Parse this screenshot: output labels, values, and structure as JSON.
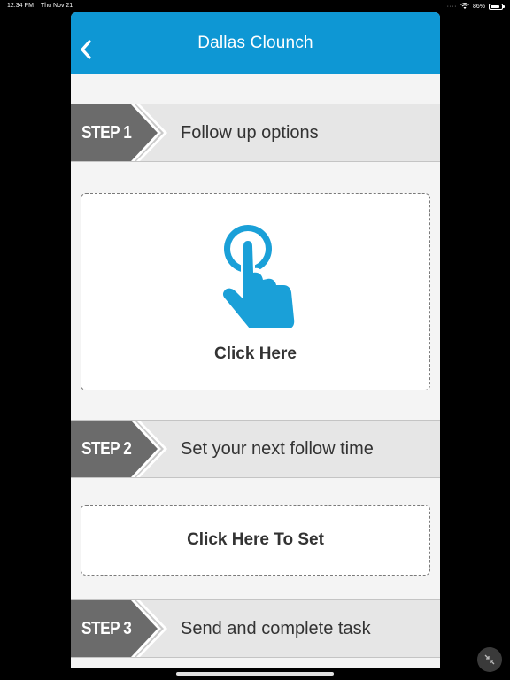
{
  "status_bar": {
    "time": "12:34 PM",
    "date": "Thu Nov 21",
    "battery": "86%",
    "battery_level": 0.86
  },
  "header": {
    "title": "Dallas Clounch",
    "back_icon": "chevron-left-icon"
  },
  "steps": [
    {
      "label": "STEP 1",
      "text": "Follow up options"
    },
    {
      "label": "STEP 2",
      "text": "Set your next follow time"
    },
    {
      "label": "STEP 3",
      "text": "Send and complete task"
    }
  ],
  "actions": {
    "click_here": "Click Here",
    "click_here_icon": "tap-hand-icon",
    "click_here_to_set": "Click Here To Set"
  },
  "colors": {
    "header": "#0e97d4",
    "accent_icon": "#1aa0d8",
    "step_tab": "#6b6b6b",
    "step_bar": "#e6e6e6"
  }
}
